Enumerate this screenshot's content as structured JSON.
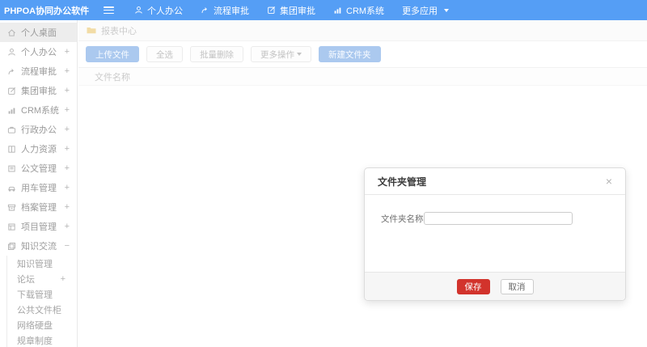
{
  "topbar": {
    "logo": "PHPOA协同办公软件",
    "nav": [
      {
        "label": "个人办公",
        "icon": "user-icon"
      },
      {
        "label": "流程审批",
        "icon": "process-icon"
      },
      {
        "label": "集团审批",
        "icon": "edit-icon"
      },
      {
        "label": "CRM系统",
        "icon": "chart-icon"
      },
      {
        "label": "更多应用",
        "icon": "caret-down-icon"
      }
    ]
  },
  "sidebar": {
    "items": [
      {
        "label": "个人桌面",
        "icon": "home-icon",
        "expand": "",
        "active": true
      },
      {
        "label": "个人办公",
        "icon": "user-icon",
        "expand": "+"
      },
      {
        "label": "流程审批",
        "icon": "process-icon",
        "expand": "+"
      },
      {
        "label": "集团审批",
        "icon": "edit-icon",
        "expand": "+"
      },
      {
        "label": "CRM系统",
        "icon": "chart-icon",
        "expand": "+"
      },
      {
        "label": "行政办公",
        "icon": "briefcase-icon",
        "expand": "+"
      },
      {
        "label": "人力资源",
        "icon": "book-icon",
        "expand": "+"
      },
      {
        "label": "公文管理",
        "icon": "document-icon",
        "expand": "+"
      },
      {
        "label": "用车管理",
        "icon": "car-icon",
        "expand": "+"
      },
      {
        "label": "档案管理",
        "icon": "archive-icon",
        "expand": "+"
      },
      {
        "label": "项目管理",
        "icon": "project-icon",
        "expand": "+"
      },
      {
        "label": "知识交流",
        "icon": "layers-icon",
        "expand": "−",
        "expanded": true
      }
    ],
    "subitems": [
      {
        "label": "知识管理",
        "expand": ""
      },
      {
        "label": "论坛",
        "expand": "+"
      },
      {
        "label": "下载管理",
        "expand": ""
      },
      {
        "label": "公共文件柜",
        "expand": ""
      },
      {
        "label": "网络硬盘",
        "expand": ""
      },
      {
        "label": "规章制度",
        "expand": ""
      }
    ]
  },
  "breadcrumb": {
    "icon": "folder-icon",
    "label": "报表中心"
  },
  "toolbar": {
    "buttons": [
      {
        "label": "上传文件",
        "style": "primary"
      },
      {
        "label": "全选",
        "style": "default"
      },
      {
        "label": "批量删除",
        "style": "default"
      },
      {
        "label": "更多操作",
        "style": "default",
        "caret": true
      },
      {
        "label": "新建文件夹",
        "style": "primary"
      }
    ]
  },
  "table": {
    "header": "文件名称"
  },
  "modal": {
    "title": "文件夹管理",
    "close": "×",
    "field_label": "文件夹名称",
    "input_value": "",
    "save_label": "保存",
    "cancel_label": "取消"
  },
  "colors": {
    "topbar_blue": "#559ef5",
    "primary_button_faded": "#abc9ef",
    "save_red": "#d2332c",
    "active_item_bg": "#ededed"
  }
}
